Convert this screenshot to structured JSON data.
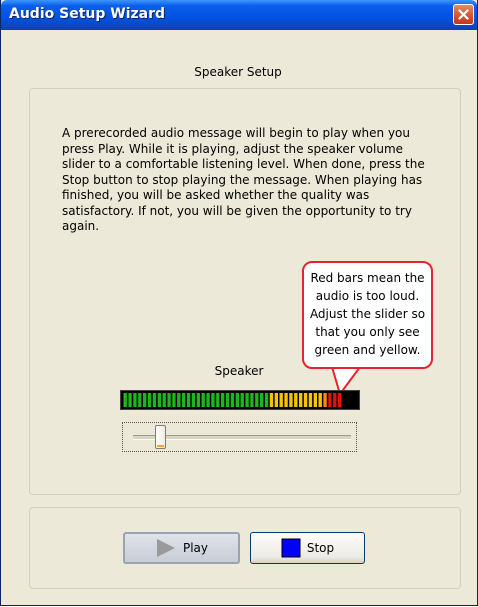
{
  "window": {
    "title": "Audio Setup Wizard",
    "close_icon": "close-icon"
  },
  "page": {
    "heading": "Speaker Setup",
    "description": "A prerecorded audio message will begin to play when you press Play.  While it is playing, adjust the speaker volume slider to a comfortable listening level.  When done, press the Stop button to stop playing the message.  When playing has finished, you will be asked whether the quality was satisfactory.  If not, you will be given the opportunity to try again.",
    "tooltip": "Red bars mean the audio is too loud.  Adjust the slider so that you only see green and yellow."
  },
  "meter": {
    "label": "Speaker",
    "total_bars": 48,
    "green_bars": 30,
    "yellow_bars": 11,
    "red_bars": 4,
    "colors": {
      "green": "#1fb51f",
      "yellow": "#f5c400",
      "orange": "#ff8c00",
      "red": "#e3120b",
      "off": "#000000"
    }
  },
  "slider": {
    "level_percent": 10
  },
  "buttons": {
    "play_label": "Play",
    "play_icon": "play-icon",
    "stop_label": "Stop",
    "stop_icon": "stop-icon"
  }
}
